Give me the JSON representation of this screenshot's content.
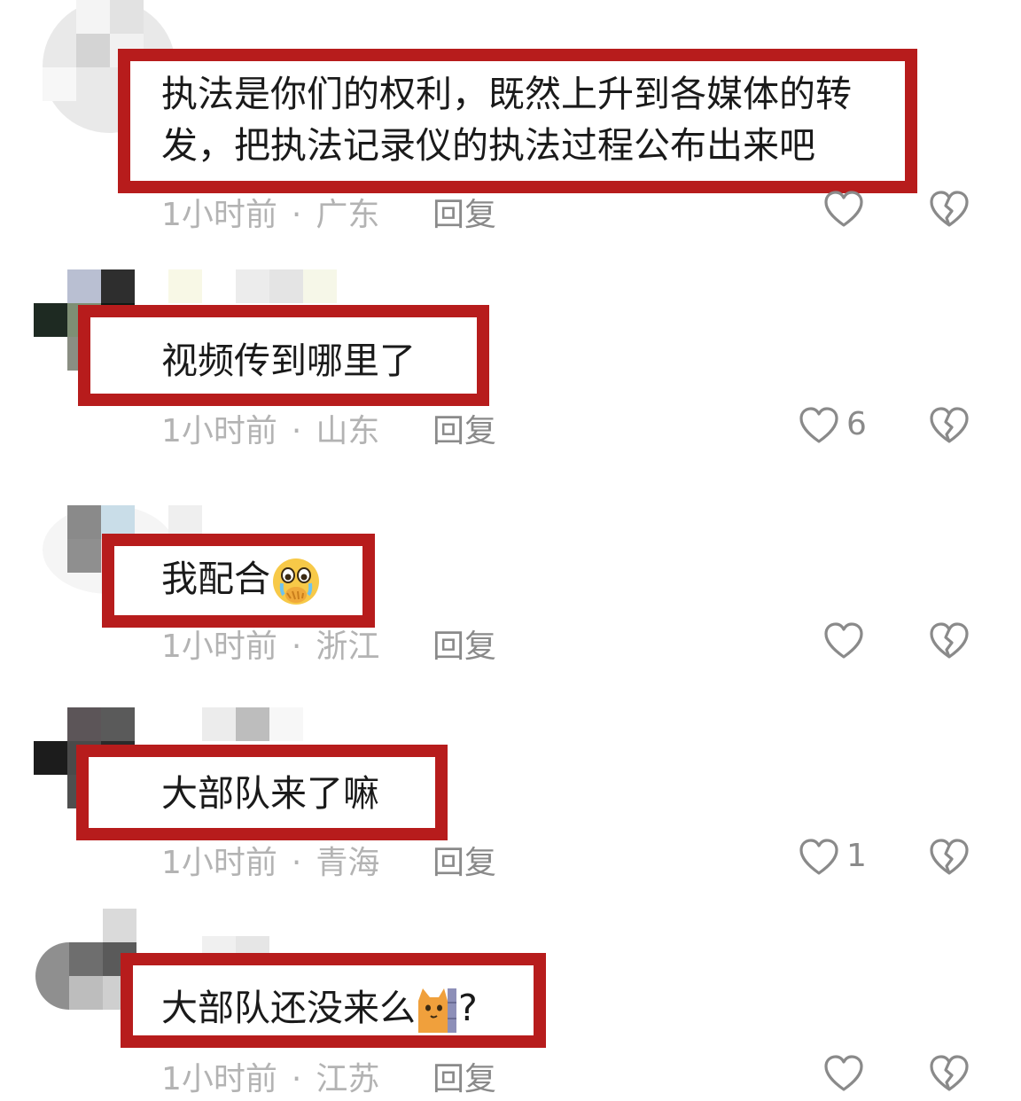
{
  "comments": [
    {
      "text_line1": "执法是你们的权利，既然上升到各媒体的转",
      "text_line2": "发，把执法记录仪的执法过程公布出来吧",
      "time": "1小时前",
      "location": "广东",
      "reply_label": "回复",
      "likes": ""
    },
    {
      "text_line1": "视频传到哪里了",
      "time": "1小时前",
      "location": "山东",
      "reply_label": "回复",
      "likes": "6"
    },
    {
      "text_line1": "我配合",
      "emoji": "crying-face-emoji",
      "time": "1小时前",
      "location": "浙江",
      "reply_label": "回复",
      "likes": ""
    },
    {
      "text_line1": "大部队来了嘛",
      "time": "1小时前",
      "location": "青海",
      "reply_label": "回复",
      "likes": "1"
    },
    {
      "text_line1": "大部队还没来么",
      "emoji": "cat-peek-emoji",
      "text_suffix": "?",
      "time": "1小时前",
      "location": "江苏",
      "reply_label": "回复",
      "likes": ""
    }
  ],
  "colors": {
    "highlight_border": "#b71c1c",
    "meta_text": "#b3b3b3",
    "icon_stroke": "#8a8a8a"
  },
  "icons": {
    "like": "heart-outline-icon",
    "dislike": "broken-heart-icon"
  }
}
